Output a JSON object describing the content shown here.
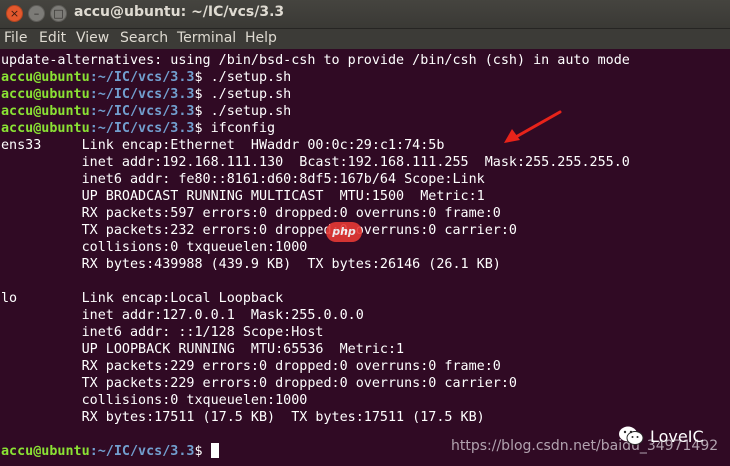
{
  "window": {
    "title": "accu@ubuntu: ~/IC/vcs/3.3",
    "close_glyph": "×",
    "minimize_glyph": "–",
    "maximize_glyph": "□"
  },
  "menubar": {
    "items": [
      "File",
      "Edit",
      "View",
      "Search",
      "Terminal",
      "Help"
    ]
  },
  "terminal": {
    "prompt_user": "accu@ubuntu",
    "prompt_path": ":~/IC/vcs/3.3",
    "prompt_symbol": "$",
    "lines": [
      {
        "kind": "output",
        "text": "update-alternatives: using /bin/bsd-csh to provide /bin/csh (csh) in auto mode"
      },
      {
        "kind": "prompt",
        "cmd": "./setup.sh"
      },
      {
        "kind": "prompt",
        "cmd": "./setup.sh"
      },
      {
        "kind": "prompt",
        "cmd": "./setup.sh"
      },
      {
        "kind": "prompt",
        "cmd": "ifconfig"
      },
      {
        "kind": "output",
        "text": "ens33     Link encap:Ethernet  HWaddr 00:0c:29:c1:74:5b"
      },
      {
        "kind": "output",
        "text": "          inet addr:192.168.111.130  Bcast:192.168.111.255  Mask:255.255.255.0"
      },
      {
        "kind": "output",
        "text": "          inet6 addr: fe80::8161:d60:8df5:167b/64 Scope:Link"
      },
      {
        "kind": "output",
        "text": "          UP BROADCAST RUNNING MULTICAST  MTU:1500  Metric:1"
      },
      {
        "kind": "output",
        "text": "          RX packets:597 errors:0 dropped:0 overruns:0 frame:0"
      },
      {
        "kind": "output",
        "text": "          TX packets:232 errors:0 dropped:0 overruns:0 carrier:0"
      },
      {
        "kind": "output",
        "text": "          collisions:0 txqueuelen:1000"
      },
      {
        "kind": "output",
        "text": "          RX bytes:439988 (439.9 KB)  TX bytes:26146 (26.1 KB)"
      },
      {
        "kind": "output",
        "text": ""
      },
      {
        "kind": "output",
        "text": "lo        Link encap:Local Loopback"
      },
      {
        "kind": "output",
        "text": "          inet addr:127.0.0.1  Mask:255.0.0.0"
      },
      {
        "kind": "output",
        "text": "          inet6 addr: ::1/128 Scope:Host"
      },
      {
        "kind": "output",
        "text": "          UP LOOPBACK RUNNING  MTU:65536  Metric:1"
      },
      {
        "kind": "output",
        "text": "          RX packets:229 errors:0 dropped:0 overruns:0 frame:0"
      },
      {
        "kind": "output",
        "text": "          TX packets:229 errors:0 dropped:0 overruns:0 carrier:0"
      },
      {
        "kind": "output",
        "text": "          collisions:0 txqueuelen:1000"
      },
      {
        "kind": "output",
        "text": "          RX bytes:17511 (17.5 KB)  TX bytes:17511 (17.5 KB)"
      },
      {
        "kind": "output",
        "text": ""
      },
      {
        "kind": "prompt",
        "cmd": "",
        "cursor": true
      }
    ]
  },
  "annotation": {
    "arrow_color": "#e8231a"
  },
  "watermarks": {
    "php_logo": "php",
    "url": "https://blog.csdn.net/baidu_34971492",
    "brand_icon": "wechat-icon",
    "brand": "LoveIC"
  },
  "colors": {
    "terminal_bg": "#300a24",
    "prompt_user": "#8ae234",
    "prompt_path": "#729fcf",
    "text": "#ffffff"
  }
}
